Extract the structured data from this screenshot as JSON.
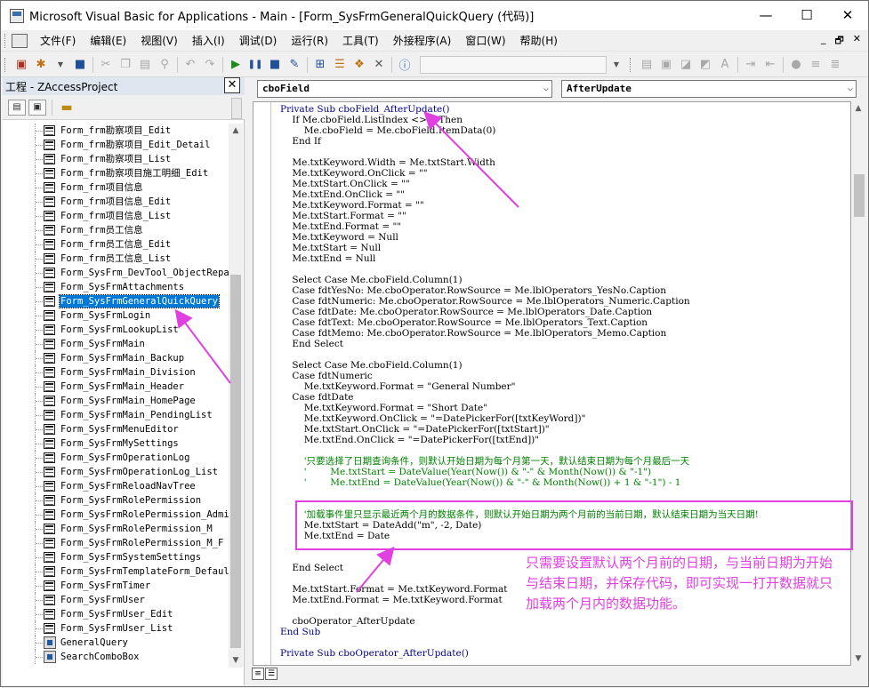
{
  "window": {
    "title": "Microsoft Visual Basic for Applications - Main - [Form_SysFrmGeneralQuickQuery (代码)]",
    "minimize_glyph": "—",
    "maximize_glyph": "☐",
    "close_glyph": "✕"
  },
  "menubar": {
    "items": [
      "文件(F)",
      "编辑(E)",
      "视图(V)",
      "插入(I)",
      "调试(D)",
      "运行(R)",
      "工具(T)",
      "外接程序(A)",
      "窗口(W)",
      "帮助(H)"
    ],
    "mdi_minimize": "_",
    "mdi_restore": "🗗",
    "mdi_close": "✕"
  },
  "project": {
    "title": "工程 - ZAccessProject",
    "close_glyph": "✕",
    "items": [
      {
        "label": "Form_frm勘察项目_Edit",
        "type": "form"
      },
      {
        "label": "Form_frm勘察项目_Edit_Detail",
        "type": "form"
      },
      {
        "label": "Form_frm勘察项目_List",
        "type": "form"
      },
      {
        "label": "Form_frm勘察项目施工明细_Edit",
        "type": "form"
      },
      {
        "label": "Form_frm项目信息",
        "type": "form"
      },
      {
        "label": "Form_frm项目信息_Edit",
        "type": "form"
      },
      {
        "label": "Form_frm项目信息_List",
        "type": "form"
      },
      {
        "label": "Form_frm员工信息",
        "type": "form"
      },
      {
        "label": "Form_frm员工信息_Edit",
        "type": "form"
      },
      {
        "label": "Form_frm员工信息_List",
        "type": "form"
      },
      {
        "label": "Form_SysFrm_DevTool_ObjectRepai",
        "type": "form"
      },
      {
        "label": "Form_SysFrmAttachments",
        "type": "form"
      },
      {
        "label": "Form_SysFrmGeneralQuickQuery",
        "type": "form",
        "selected": true
      },
      {
        "label": "Form_SysFrmLogin",
        "type": "form"
      },
      {
        "label": "Form_SysFrmLookupList",
        "type": "form"
      },
      {
        "label": "Form_SysFrmMain",
        "type": "form"
      },
      {
        "label": "Form_SysFrmMain_Backup",
        "type": "form"
      },
      {
        "label": "Form_SysFrmMain_Division",
        "type": "form"
      },
      {
        "label": "Form_SysFrmMain_Header",
        "type": "form"
      },
      {
        "label": "Form_SysFrmMain_HomePage",
        "type": "form"
      },
      {
        "label": "Form_SysFrmMain_PendingList",
        "type": "form"
      },
      {
        "label": "Form_SysFrmMenuEditor",
        "type": "form"
      },
      {
        "label": "Form_SysFrmMySettings",
        "type": "form"
      },
      {
        "label": "Form_SysFrmOperationLog",
        "type": "form"
      },
      {
        "label": "Form_SysFrmOperationLog_List",
        "type": "form"
      },
      {
        "label": "Form_SysFrmReloadNavTree",
        "type": "form"
      },
      {
        "label": "Form_SysFrmRolePermission",
        "type": "form"
      },
      {
        "label": "Form_SysFrmRolePermission_Admin",
        "type": "form"
      },
      {
        "label": "Form_SysFrmRolePermission_M",
        "type": "form"
      },
      {
        "label": "Form_SysFrmRolePermission_M_F",
        "type": "form"
      },
      {
        "label": "Form_SysFrmSystemSettings",
        "type": "form"
      },
      {
        "label": "Form_SysFrmTemplateForm_Default",
        "type": "form"
      },
      {
        "label": "Form_SysFrmTimer",
        "type": "form"
      },
      {
        "label": "Form_SysFrmUser",
        "type": "form"
      },
      {
        "label": "Form_SysFrmUser_Edit",
        "type": "form"
      },
      {
        "label": "Form_SysFrmUser_List",
        "type": "form"
      },
      {
        "label": "GeneralQuery",
        "type": "module"
      },
      {
        "label": "SearchComboBox",
        "type": "module"
      }
    ]
  },
  "code": {
    "object_combo": "cboField",
    "procedure_combo": "AfterUpdate",
    "lines": [
      {
        "t": "Private Sub cboField_AfterUpdate()",
        "c": "kw"
      },
      {
        "t": "    If Me.cboField.ListIndex <> 0 Then",
        "c": ""
      },
      {
        "t": "        Me.cboField = Me.cboField.ItemData(0)",
        "c": ""
      },
      {
        "t": "    End If",
        "c": ""
      },
      {
        "t": "",
        "c": ""
      },
      {
        "t": "    Me.txtKeyword.Width = Me.txtStart.Width",
        "c": ""
      },
      {
        "t": "    Me.txtKeyword.OnClick = \"\"",
        "c": ""
      },
      {
        "t": "    Me.txtStart.OnClick = \"\"",
        "c": ""
      },
      {
        "t": "    Me.txtEnd.OnClick = \"\"",
        "c": ""
      },
      {
        "t": "    Me.txtKeyword.Format = \"\"",
        "c": ""
      },
      {
        "t": "    Me.txtStart.Format = \"\"",
        "c": ""
      },
      {
        "t": "    Me.txtEnd.Format = \"\"",
        "c": ""
      },
      {
        "t": "    Me.txtKeyword = Null",
        "c": ""
      },
      {
        "t": "    Me.txtStart = Null",
        "c": ""
      },
      {
        "t": "    Me.txtEnd = Null",
        "c": ""
      },
      {
        "t": "",
        "c": ""
      },
      {
        "t": "    Select Case Me.cboField.Column(1)",
        "c": ""
      },
      {
        "t": "    Case fdtYesNo: Me.cboOperator.RowSource = Me.lblOperators_YesNo.Caption",
        "c": ""
      },
      {
        "t": "    Case fdtNumeric: Me.cboOperator.RowSource = Me.lblOperators_Numeric.Caption",
        "c": ""
      },
      {
        "t": "    Case fdtDate: Me.cboOperator.RowSource = Me.lblOperators_Date.Caption",
        "c": ""
      },
      {
        "t": "    Case fdtText: Me.cboOperator.RowSource = Me.lblOperators_Text.Caption",
        "c": ""
      },
      {
        "t": "    Case fdtMemo: Me.cboOperator.RowSource = Me.lblOperators_Memo.Caption",
        "c": ""
      },
      {
        "t": "    End Select",
        "c": ""
      },
      {
        "t": "",
        "c": ""
      },
      {
        "t": "    Select Case Me.cboField.Column(1)",
        "c": ""
      },
      {
        "t": "    Case fdtNumeric",
        "c": ""
      },
      {
        "t": "        Me.txtKeyword.Format = \"General Number\"",
        "c": ""
      },
      {
        "t": "    Case fdtDate",
        "c": ""
      },
      {
        "t": "        Me.txtKeyword.Format = \"Short Date\"",
        "c": ""
      },
      {
        "t": "        Me.txtKeyword.OnClick = \"=DatePickerFor([txtKeyWord])\"",
        "c": ""
      },
      {
        "t": "        Me.txtStart.OnClick = \"=DatePickerFor([txtStart])\"",
        "c": ""
      },
      {
        "t": "        Me.txtEnd.OnClick = \"=DatePickerFor([txtEnd])\"",
        "c": ""
      },
      {
        "t": "",
        "c": ""
      },
      {
        "t": "        '只要选择了日期查询条件，则默认开始日期为每个月第一天，默认结束日期为每个月最后一天",
        "c": "cm"
      },
      {
        "t": "        '        Me.txtStart = DateValue(Year(Now()) & \"-\" & Month(Now()) & \"-1\")",
        "c": "cm"
      },
      {
        "t": "        '        Me.txtEnd = DateValue(Year(Now()) & \"-\" & Month(Now()) + 1 & \"-1\") - 1",
        "c": "cm"
      },
      {
        "t": "",
        "c": ""
      },
      {
        "t": "",
        "c": ""
      },
      {
        "t": "        '加载事件里只显示最近两个月的数据条件，则默认开始日期为两个月前的当前日期，默认结束日期为当天日期!",
        "c": "cm"
      },
      {
        "t": "        Me.txtStart = DateAdd(\"m\", -2, Date)",
        "c": ""
      },
      {
        "t": "        Me.txtEnd = Date",
        "c": ""
      },
      {
        "t": "",
        "c": ""
      },
      {
        "t": "",
        "c": ""
      },
      {
        "t": "    End Select",
        "c": ""
      },
      {
        "t": "",
        "c": ""
      },
      {
        "t": "    Me.txtStart.Format = Me.txtKeyword.Format",
        "c": ""
      },
      {
        "t": "    Me.txtEnd.Format = Me.txtKeyword.Format",
        "c": ""
      },
      {
        "t": "",
        "c": ""
      },
      {
        "t": "    cboOperator_AfterUpdate",
        "c": ""
      },
      {
        "t": "End Sub",
        "c": "kw"
      },
      {
        "t": "",
        "c": ""
      },
      {
        "t": "Private Sub cboOperator_AfterUpdate()",
        "c": "kw"
      }
    ]
  },
  "annotation": {
    "text_lines": [
      "只需要设置默认两个月前的日期，与当前日期为开始",
      "与结束日期，并保存代码，即可实现一打开数据就只",
      "加载两个月内的数据功能。"
    ],
    "color": "#e040e0"
  }
}
